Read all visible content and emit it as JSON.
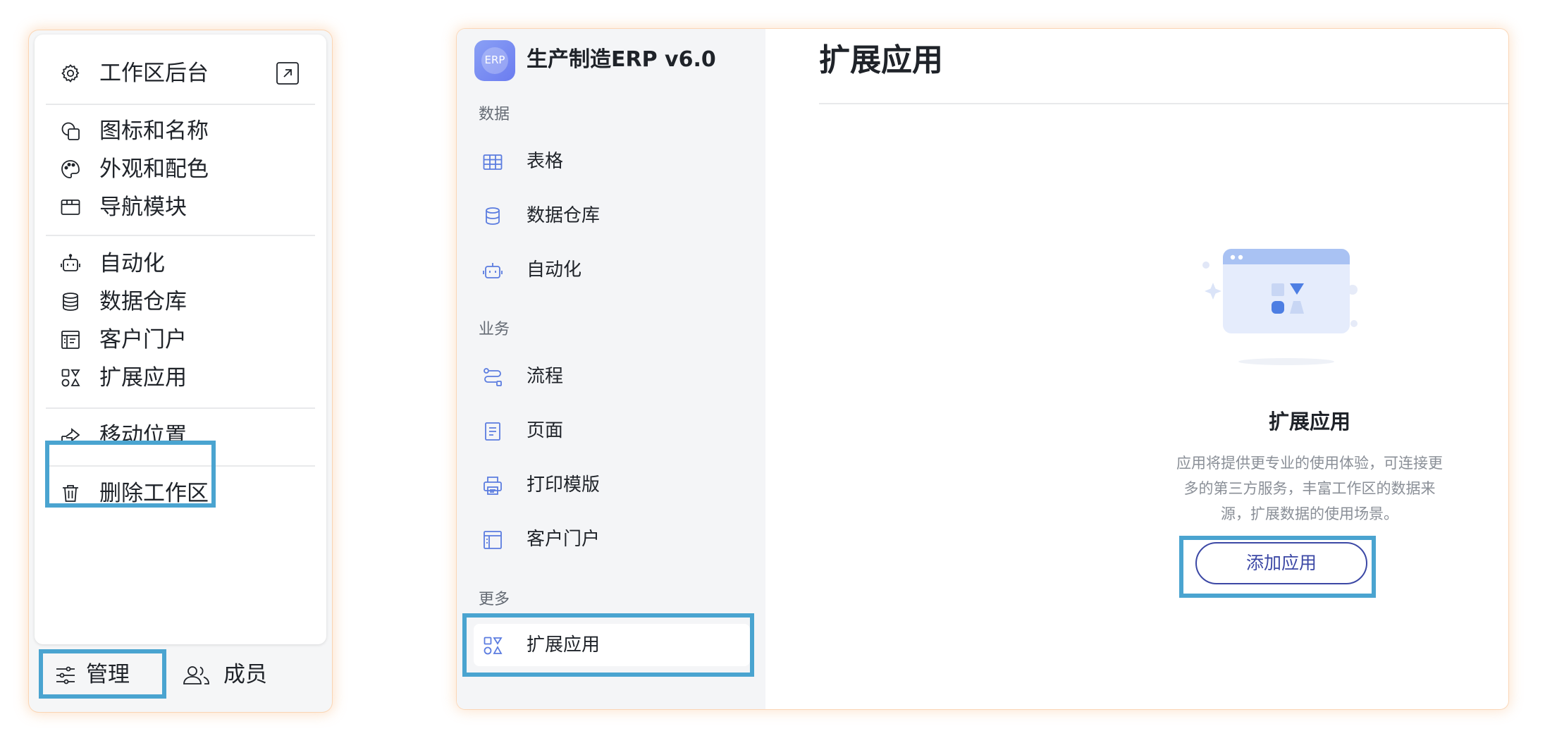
{
  "manage_menu": {
    "items": [
      {
        "label": "工作区后台",
        "icon": "gear-icon",
        "trailing_icon": "external-link-icon"
      },
      {
        "label": "图标和名称",
        "icon": "shapes-icon"
      },
      {
        "label": "外观和配色",
        "icon": "palette-icon"
      },
      {
        "label": "导航模块",
        "icon": "nav-module-icon"
      },
      {
        "label": "自动化",
        "icon": "robot-icon"
      },
      {
        "label": "数据仓库",
        "icon": "database-icon"
      },
      {
        "label": "客户门户",
        "icon": "portal-icon"
      },
      {
        "label": "扩展应用",
        "icon": "apps-icon",
        "highlighted": true
      },
      {
        "label": "移动位置",
        "icon": "move-icon"
      },
      {
        "label": "删除工作区",
        "icon": "trash-icon"
      }
    ]
  },
  "bottom_bar": {
    "manage_label": "管理",
    "members_label": "成员",
    "manage_highlighted": true
  },
  "app": {
    "logo_text": "ERP",
    "name": "生产制造ERP v6.0"
  },
  "sidebar": {
    "sections": [
      {
        "label": "数据",
        "items": [
          {
            "label": "表格",
            "icon": "table-icon"
          },
          {
            "label": "数据仓库",
            "icon": "database-icon"
          },
          {
            "label": "自动化",
            "icon": "robot-icon"
          }
        ]
      },
      {
        "label": "业务",
        "items": [
          {
            "label": "流程",
            "icon": "flow-icon"
          },
          {
            "label": "页面",
            "icon": "page-icon"
          },
          {
            "label": "打印模版",
            "icon": "printer-icon"
          },
          {
            "label": "客户门户",
            "icon": "portal-icon"
          }
        ]
      },
      {
        "label": "更多",
        "items": [
          {
            "label": "扩展应用",
            "icon": "apps-icon",
            "active": true
          }
        ]
      }
    ]
  },
  "main": {
    "title": "扩展应用",
    "empty_state": {
      "title": "扩展应用",
      "description": "应用将提供更专业的使用体验，可连接更多的第三方服务，丰富工作区的数据来源，扩展数据的使用场景。",
      "button_label": "添加应用"
    }
  },
  "colors": {
    "highlight_border": "#4aa4d0",
    "accent": "#3c48a5",
    "icon_blue": "#5b7ce0",
    "sidebar_bg": "#f4f5f7"
  }
}
